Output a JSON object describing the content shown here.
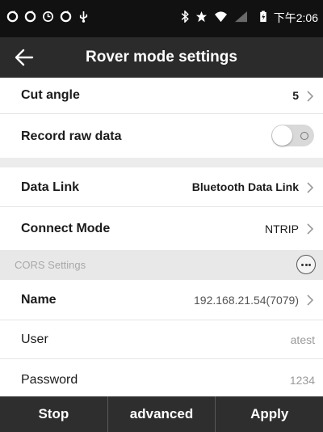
{
  "status_bar": {
    "time": "下午2:06",
    "left_icons": [
      "sync-icon",
      "sync-icon",
      "clock-icon",
      "sync-icon",
      "usb-icon"
    ],
    "right_icons": [
      "bluetooth-icon",
      "star-icon",
      "wifi-icon",
      "signal-icon",
      "battery-icon"
    ]
  },
  "app_bar": {
    "title": "Rover mode settings",
    "back_icon": "arrow-left-icon"
  },
  "settings": {
    "cut_angle": {
      "label": "Cut angle",
      "value": "5"
    },
    "record_raw_data": {
      "label": "Record raw data",
      "enabled": false
    },
    "data_link": {
      "label": "Data Link",
      "value": "Bluetooth Data Link"
    },
    "connect_mode": {
      "label": "Connect Mode",
      "value": "NTRIP"
    }
  },
  "cors": {
    "section_label": "CORS Settings",
    "name": {
      "label": "Name",
      "value": "192.168.21.54(7079)"
    },
    "user": {
      "label": "User",
      "value": "atest"
    },
    "password": {
      "label": "Password",
      "value": "1234"
    }
  },
  "bottom_bar": {
    "stop": "Stop",
    "advanced": "advanced",
    "apply": "Apply"
  },
  "colors": {
    "status_bar_bg": "#111111",
    "app_bar_bg": "#2b2b2b",
    "bottom_bar_bg": "#2e2e2e",
    "section_bg": "#e8e8e8",
    "muted_text": "#9a9a9a"
  }
}
